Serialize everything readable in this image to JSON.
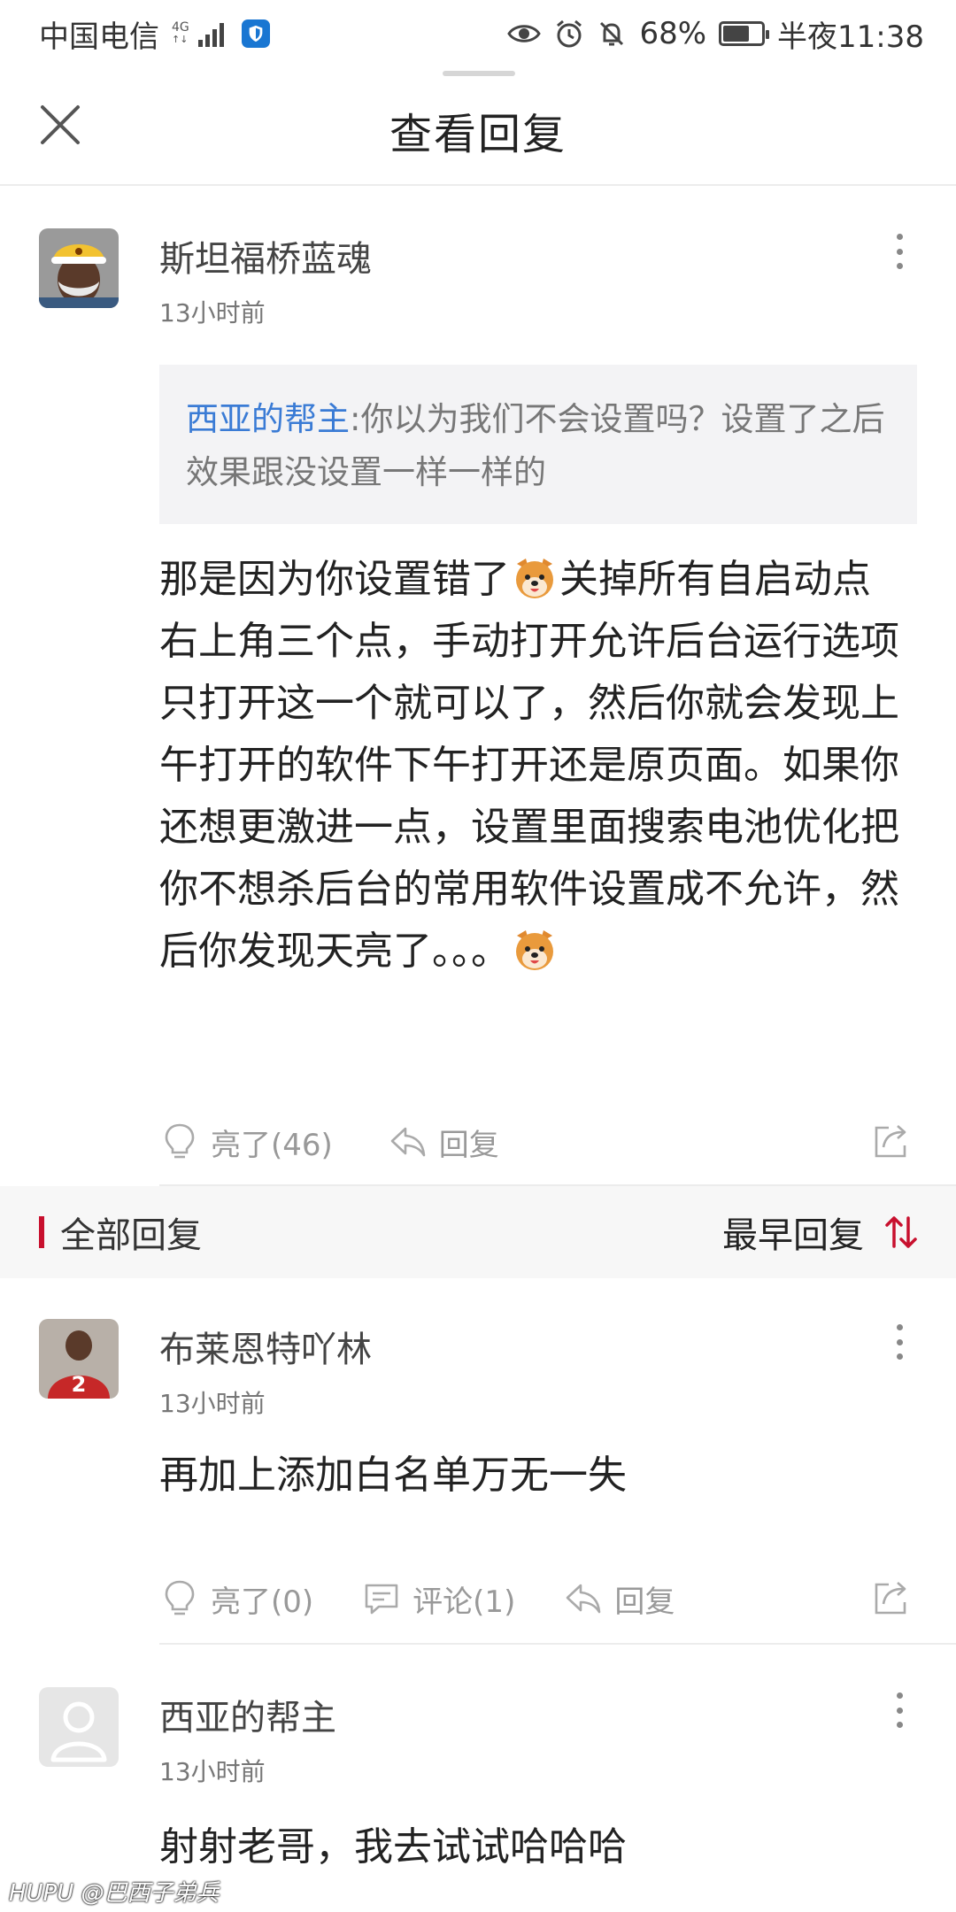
{
  "status_bar": {
    "carrier": "中国电信",
    "network": "4G",
    "battery_percent": "68%",
    "battery_level": 0.68,
    "time": "半夜11:38"
  },
  "header": {
    "title": "查看回复"
  },
  "main_comment": {
    "username": "斯坦福桥蓝魂",
    "time": "13小时前",
    "quote_author": "西亚的帮主",
    "quote_text": ":你以为我们不会设置吗？设置了之后效果跟没设置一样一样的",
    "text_part1": "那是因为你设置错了",
    "text_part2": "关掉所有自启动点右上角三个点，手动打开允许后台运行选项只打开这一个就可以了，然后你就会发现上午打开的软件下午打开还是原页面。如果你还想更激进一点，设置里面搜索电池优化把你不想杀后台的常用软件设置成不允许，然后你发现天亮了。。。",
    "emoji_name": "dog-emoji",
    "like_label": "亮了(46)",
    "reply_label": "回复"
  },
  "section": {
    "title": "全部回复",
    "sort_label": "最早回复"
  },
  "replies": [
    {
      "username": "布莱恩特吖林",
      "time": "13小时前",
      "text": "再加上添加白名单万无一失",
      "like_label": "亮了(0)",
      "comment_label": "评论(1)",
      "reply_label": "回复"
    },
    {
      "username": "西亚的帮主",
      "time": "13小时前",
      "text": "射射老哥，我去试试哈哈哈"
    }
  ],
  "watermark": "HUPU @巴西子弟兵",
  "colors": {
    "accent_red": "#c8102e",
    "link_blue": "#3a7bd5",
    "muted_gray": "#999999"
  }
}
